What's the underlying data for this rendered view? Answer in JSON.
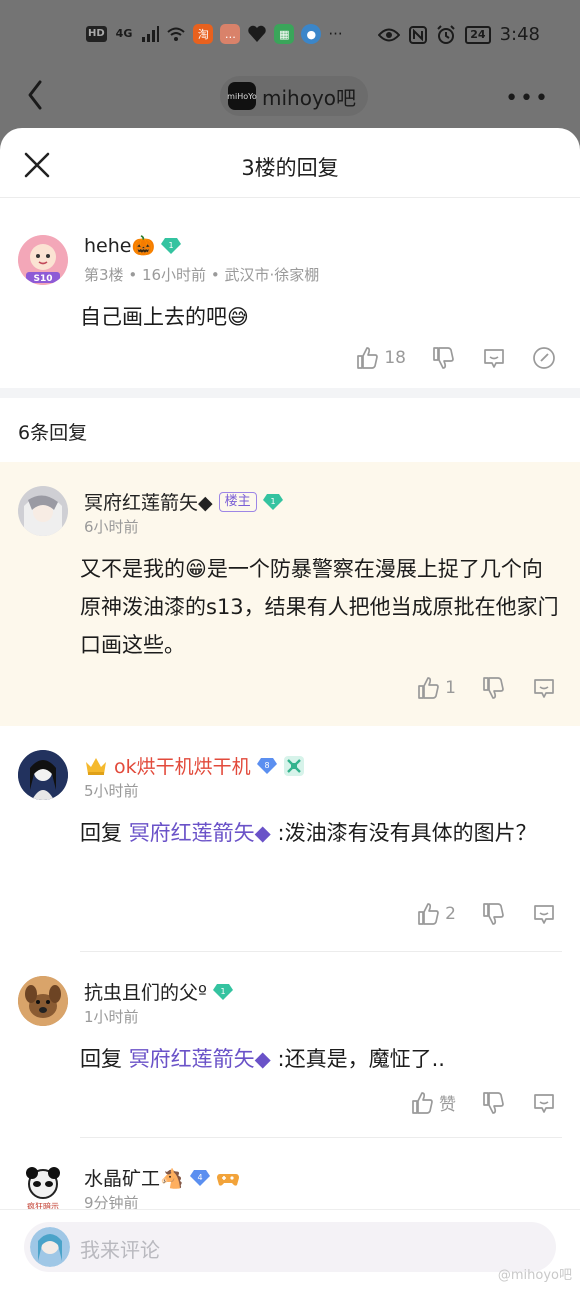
{
  "status_bar": {
    "left_badges": [
      "HD",
      "4G"
    ],
    "time": "3:48",
    "battery": "24"
  },
  "nav": {
    "forum_name": "mihoyo吧",
    "logo_text": "miHoYo"
  },
  "sheet": {
    "title": "3楼的回复"
  },
  "post": {
    "username": "hehe🎃",
    "level": "1",
    "floor": "第3楼",
    "time": "16小时前",
    "location": "武汉市·徐家棚",
    "content": "自己画上去的吧😅",
    "like_count": "18",
    "avatar_tag": "S10"
  },
  "reply_count": "6条回复",
  "replies": [
    {
      "username": "冥府红莲箭矢◆",
      "host_badge": "楼主",
      "level": "1",
      "time": "6小时前",
      "content": "又不是我的😁是一个防暴警察在漫展上捉了几个向原神泼油漆的s13，结果有人把他当成原批在他家门口画这些。",
      "like_count": "1"
    },
    {
      "username": "ok烘干机烘干机",
      "level": "8",
      "time": "5小时前",
      "reply_prefix": "回复",
      "mention": "冥府红莲箭矢◆",
      "content": " :泼油漆有没有具体的图片？",
      "like_count": "2"
    },
    {
      "username": "抗虫且们的父º",
      "level": "1",
      "time": "1小时前",
      "reply_prefix": "回复",
      "mention": "冥府红莲箭矢◆",
      "content": " :还真是，魔怔了..",
      "like_label": "赞"
    },
    {
      "username": "水晶矿工🐴",
      "level": "4",
      "time": "9分钟前",
      "avatar_caption": "疯狂暗示"
    }
  ],
  "input": {
    "placeholder": "我来评论"
  },
  "watermark": "@mihoyo吧",
  "colors": {
    "accent_purple": "#6a52c8",
    "level_green": "#34c3a0",
    "level_blue": "#5b8ff0",
    "highlight_bg": "#fdf8ec",
    "red_name": "#e24a3b"
  }
}
